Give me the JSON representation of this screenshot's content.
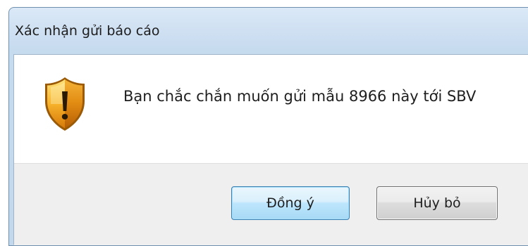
{
  "window": {
    "title": "Xác nhận gửi báo cáo"
  },
  "dialog": {
    "icon": "warning-shield-icon",
    "message": "Bạn chắc chắn muốn gửi mẫu 8966 này tới SBV"
  },
  "buttons": {
    "confirm_label": "Đồng ý",
    "cancel_label": "Hủy bỏ"
  }
}
